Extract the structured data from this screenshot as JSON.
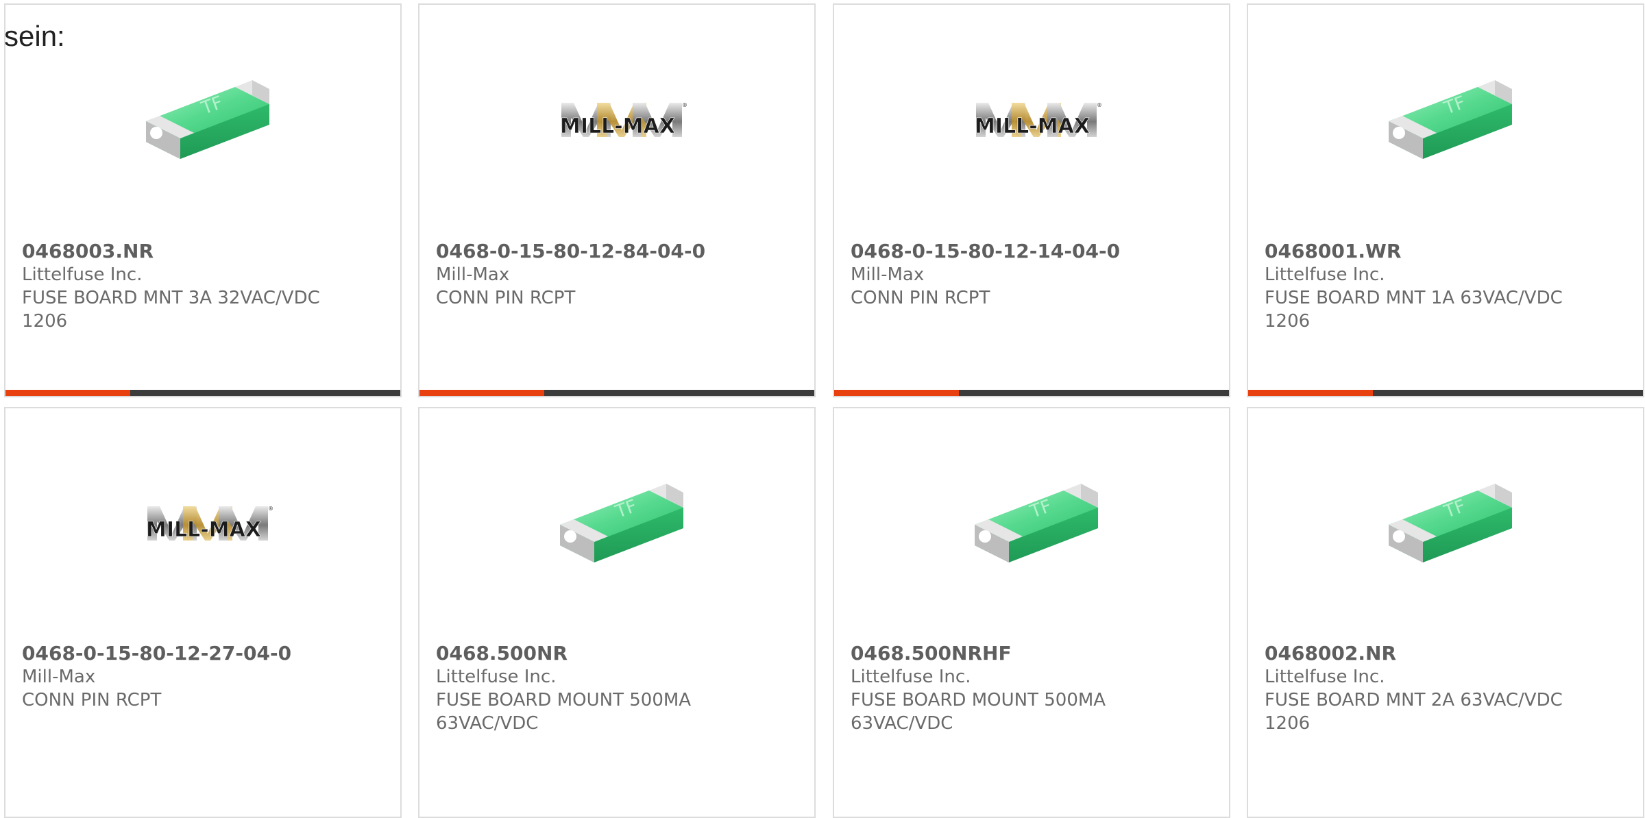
{
  "heading": "sein:",
  "colors": {
    "accent": "#e8400e",
    "bar_dark": "#3c3c3c",
    "fuse_green": "#3fd37e"
  },
  "products": [
    {
      "part_number": "0468003.NR",
      "manufacturer": "Littelfuse Inc.",
      "description": "FUSE BOARD MNT 3A 32VAC/VDC 1206",
      "image": "fuse-icon"
    },
    {
      "part_number": "0468-0-15-80-12-84-04-0",
      "manufacturer": "Mill-Max",
      "description": "CONN PIN RCPT",
      "image": "mill-max-logo"
    },
    {
      "part_number": "0468-0-15-80-12-14-04-0",
      "manufacturer": "Mill-Max",
      "description": "CONN PIN RCPT",
      "image": "mill-max-logo"
    },
    {
      "part_number": "0468001.WR",
      "manufacturer": "Littelfuse Inc.",
      "description": "FUSE BOARD MNT 1A 63VAC/VDC 1206",
      "image": "fuse-icon"
    },
    {
      "part_number": "0468-0-15-80-12-27-04-0",
      "manufacturer": "Mill-Max",
      "description": "CONN PIN RCPT",
      "image": "mill-max-logo"
    },
    {
      "part_number": "0468.500NR",
      "manufacturer": "Littelfuse Inc.",
      "description": "FUSE BOARD MOUNT 500MA 63VAC/VDC",
      "image": "fuse-icon"
    },
    {
      "part_number": "0468.500NRHF",
      "manufacturer": "Littelfuse Inc.",
      "description": "FUSE BOARD MOUNT 500MA 63VAC/VDC",
      "image": "fuse-icon"
    },
    {
      "part_number": "0468002.NR",
      "manufacturer": "Littelfuse Inc.",
      "description": "FUSE BOARD MNT 2A 63VAC/VDC 1206",
      "image": "fuse-icon"
    }
  ]
}
